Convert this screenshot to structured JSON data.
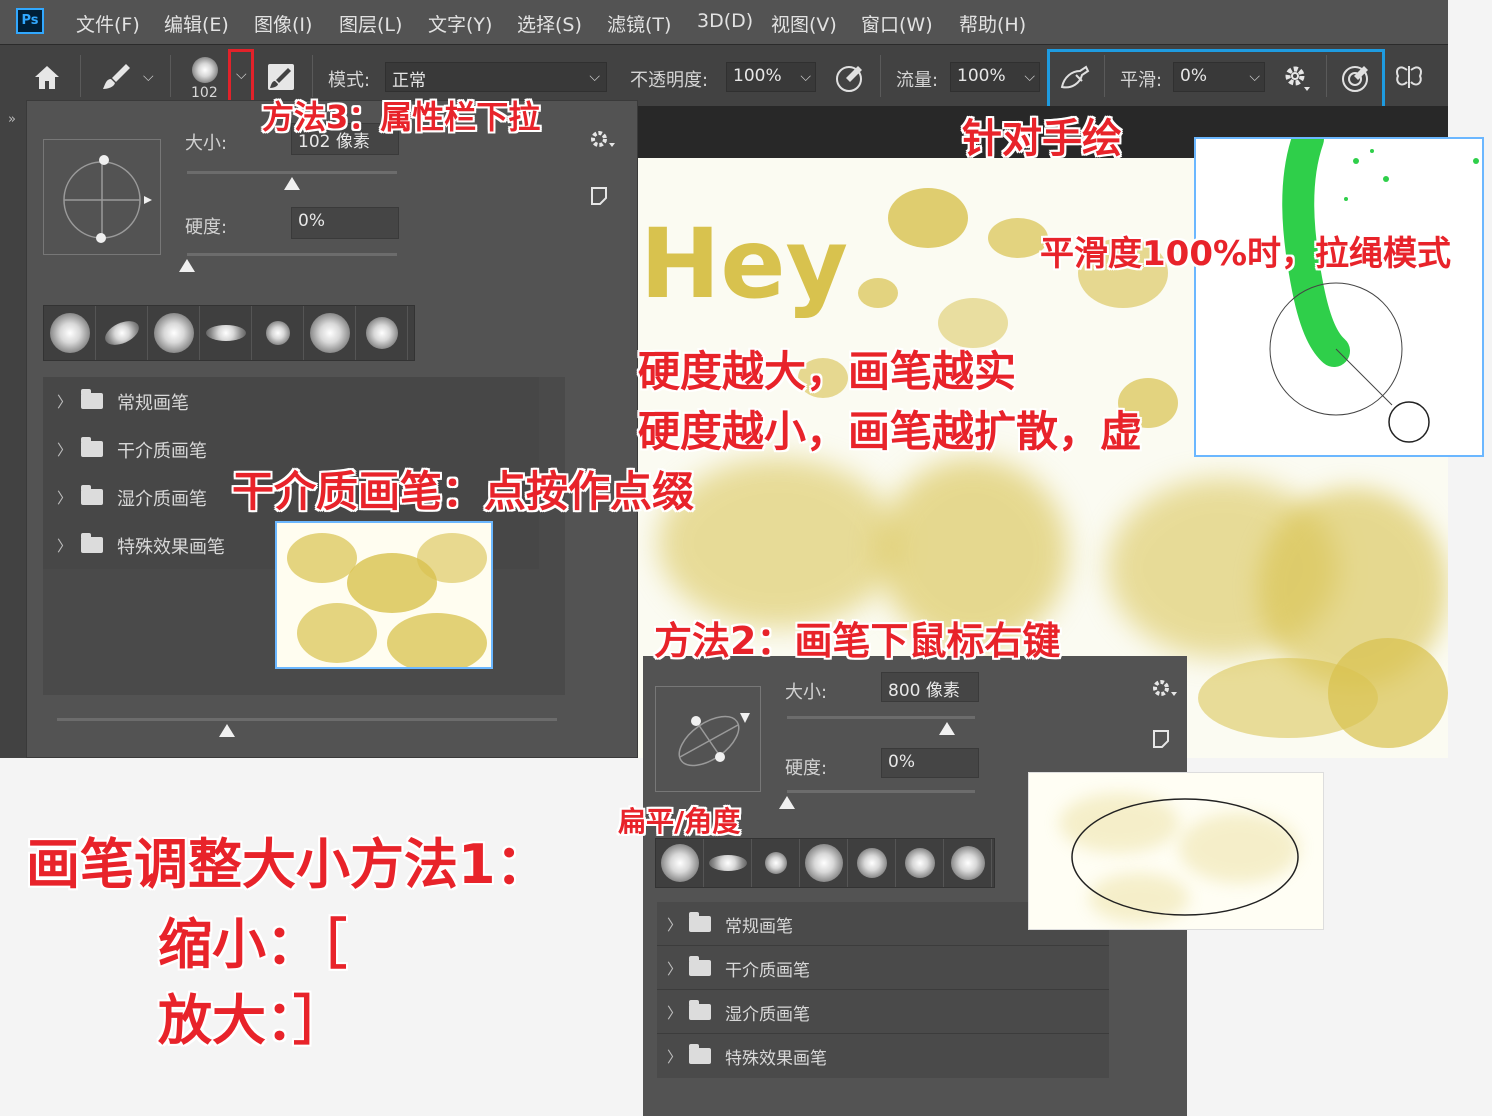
{
  "app": {
    "logo": "Ps"
  },
  "menu": [
    "文件(F)",
    "编辑(E)",
    "图像(I)",
    "图层(L)",
    "文字(Y)",
    "选择(S)",
    "滤镜(T)",
    "3D(D)",
    "视图(V)",
    "窗口(W)",
    "帮助(H)"
  ],
  "options": {
    "brush_size": "102",
    "mode_label": "模式:",
    "mode_value": "正常",
    "opacity_label": "不透明度:",
    "opacity_value": "100%",
    "flow_label": "流量:",
    "flow_value": "100%",
    "smoothing_label": "平滑:",
    "smoothing_value": "0%"
  },
  "brush_panel_1": {
    "size_label": "大小:",
    "size_value": "102 像素",
    "hardness_label": "硬度:",
    "hardness_value": "0%",
    "size_slider": 0.5,
    "hardness_slider": 0,
    "folders": [
      "常规画笔",
      "干介质画笔",
      "湿介质画笔",
      "特殊效果画笔"
    ]
  },
  "brush_panel_2": {
    "size_label": "大小:",
    "size_value": "800 像素",
    "hardness_label": "硬度:",
    "hardness_value": "0%",
    "size_slider": 0.85,
    "hardness_slider": 0,
    "folders": [
      "常规画笔",
      "干介质画笔",
      "湿介质画笔",
      "特殊效果画笔"
    ]
  },
  "canvas": {
    "sample_text": "Hey"
  },
  "annotations": {
    "method3": "方法3：属性栏下拉",
    "handdraw": "针对手绘",
    "smoothing_note": "平滑度100%时，拉绳模式",
    "hardness_1": "硬度越大，画笔越实",
    "hardness_2": "硬度越小，画笔越扩散，虚",
    "dry_media": "干介质画笔：点按作点缀",
    "method2": "方法2：画笔下鼠标右键",
    "flat_angle": "扁平/角度",
    "method1_title": "画笔调整大小方法1：",
    "shrink": "缩小：［",
    "enlarge": "放大：］"
  },
  "colors": {
    "accent_red": "#e8232a",
    "accent_blue": "#1e9be0",
    "paint_yellow": "#d8c24e",
    "paint_green": "#2fcf4a"
  }
}
